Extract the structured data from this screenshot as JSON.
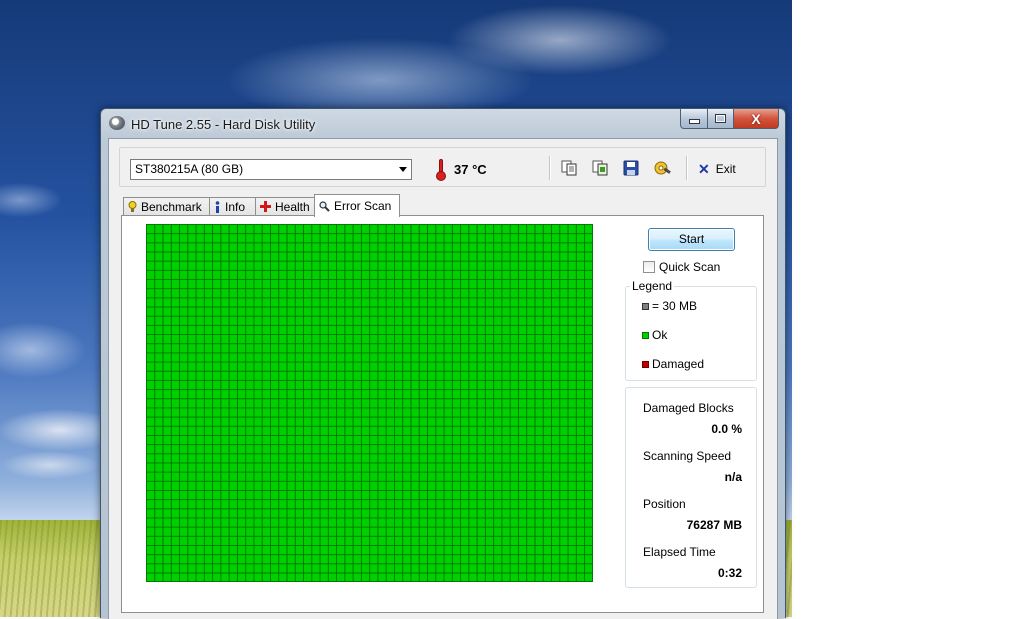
{
  "window": {
    "title": "HD Tune 2.55 - Hard Disk Utility",
    "icon": "hard-disk-icon",
    "caption_buttons": [
      "minimize-icon",
      "maximize-icon",
      "close-icon"
    ],
    "close_glyph": "X"
  },
  "toolbar": {
    "drive": "ST380215A (80 GB)",
    "temperature": "37 °C",
    "icons": [
      "copy-info-icon",
      "copy-all-icon",
      "save-icon",
      "options-icon"
    ],
    "exit_label": "Exit"
  },
  "tabs": [
    {
      "label": "Benchmark",
      "icon": "benchmark-icon",
      "active": false
    },
    {
      "label": "Info",
      "icon": "info-icon",
      "active": false
    },
    {
      "label": "Health",
      "icon": "health-icon",
      "active": false
    },
    {
      "label": "Error Scan",
      "icon": "magnifier-icon",
      "active": true
    }
  ],
  "error_scan": {
    "start_label": "Start",
    "quick_scan_label": "Quick Scan",
    "quick_scan_checked": false,
    "legend": {
      "title": "Legend",
      "items": [
        {
          "label": "= 30 MB",
          "color": "#808080"
        },
        {
          "label": "Ok",
          "color": "#00d000"
        },
        {
          "label": "Damaged",
          "color": "#c00000"
        }
      ]
    },
    "stats": [
      {
        "label": "Damaged Blocks",
        "value": "0.0 %"
      },
      {
        "label": "Scanning Speed",
        "value": "n/a"
      },
      {
        "label": "Position",
        "value": "76287 MB"
      },
      {
        "label": "Elapsed Time",
        "value": "0:32"
      }
    ],
    "block_status": "all ok",
    "block_color_ok": "#00d000",
    "block_grid_color": "#007a00"
  }
}
